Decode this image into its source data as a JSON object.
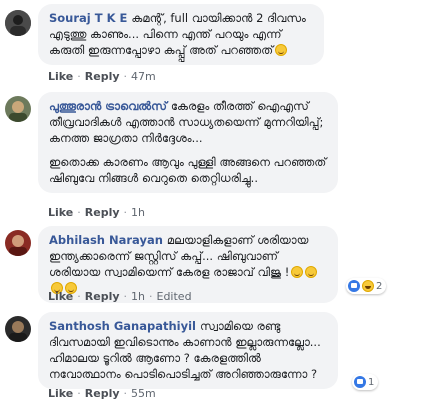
{
  "comments": [
    {
      "author": "Souraj T K E",
      "lines": [
        "കമന്റ്, full വായിക്കാൻ 2 ദിവസം എടുത്തു കാണും... പിന്നെ എന്ത് പറയും എന്ന് കരുതി ഇരുന്നപ്പോഴാ കപ്പ്പ് അത് പറഞ്ഞത്"
      ],
      "emoji": "smile-emoji",
      "like": "Like",
      "reply": "Reply",
      "time": "47m"
    },
    {
      "author": "പുത്തൂരാൻ ട്രാവെൽസ്",
      "lines": [
        "കേരളം തീരത്ത് ഐഎസ് തീവ്രവാദികൾ എത്താൻ സാധ്യതയെന്ന് മുന്നറിയിപ്പ്; കനത്ത ജാഗ്രതാ നിർദ്ദേശം...",
        "ഇതൊക്ക കാരണം ആവും പുള്ളി അങ്ങനെ പറഞ്ഞത് ഷിബുവേ നിങ്ങൾ വെറുതെ തെറ്റിധരിച്ചു.."
      ],
      "like": "Like",
      "reply": "Reply",
      "time": "1h"
    },
    {
      "author": "Abhilash Narayan",
      "lines": [
        "മലയാളികളാണ് ശരിയായ ഇന്ത്യക്കാരെന്ന് ജസ്റ്റിസ് കപ്പ്... ഷിബുവാണ് ശരിയായ സ്വാമിയെന്ന് കേരള രാജാവ് വിജു !"
      ],
      "emoji_count": 4,
      "like": "Like",
      "reply": "Reply",
      "time": "1h",
      "edited": "Edited",
      "reactions": {
        "count": "2",
        "icons": [
          "like-reaction",
          "haha-reaction"
        ]
      }
    },
    {
      "author": "Santhosh Ganapathiyil",
      "lines": [
        "സ്വാമിയെ രണ്ടു ദിവസമായി ഇവിടൊന്നും കാണാൻ ഇല്ലാരുന്നല്ലോ... ഹിമാലയ ടൂറിൽ ആണോ ? കേരളത്തിൽ നവോത്ഥാനം പൊടിപൊടിച്ചത് അറിഞ്ഞാരുന്നോ ?"
      ],
      "like": "Like",
      "reply": "Reply",
      "time": "55m",
      "reactions": {
        "count": "1",
        "icons": [
          "like-reaction"
        ]
      }
    }
  ]
}
